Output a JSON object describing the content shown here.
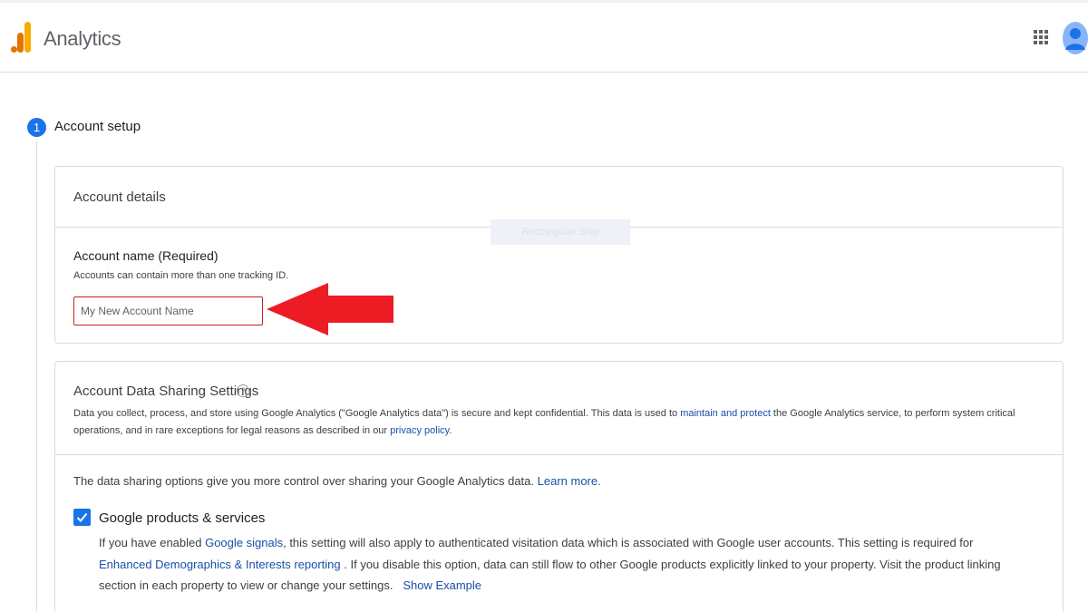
{
  "header": {
    "app_title": "Analytics",
    "logo_icon": "analytics-bars-icon",
    "apps_icon": "apps-grid-icon",
    "avatar_icon": "account-avatar-icon",
    "colors": {
      "logo_orange": "#f9ab00",
      "logo_dark_orange": "#e37400",
      "avatar_blue": "#8ab4f8"
    }
  },
  "step": {
    "number": "1",
    "label": "Account setup",
    "color": "#1a73e8"
  },
  "account_details": {
    "title": "Account details",
    "name_label": "Account name (Required)",
    "name_hint": "Accounts can contain more than one tracking ID.",
    "name_placeholder": "My New Account Name",
    "error_border_color": "#c5221f"
  },
  "overlay": {
    "ghost_tooltip": "Rectangular Snip",
    "arrow_color": "#ed1c24"
  },
  "data_sharing": {
    "title": "Account Data Sharing Settings",
    "help_icon": "?",
    "desc_part1": "Data you collect, process, and store using Google Analytics (\"Google Analytics data\") is secure and kept confidential. This data is used to ",
    "desc_link1": "maintain and protect",
    "desc_part2": " the Google Analytics service, to perform system critical operations, and in rare exceptions for legal reasons as described in our ",
    "desc_link2": "privacy policy",
    "desc_part3": ".",
    "options_intro": "The data sharing options give you more control over sharing your Google Analytics data.",
    "learn_more": "Learn more.",
    "option": {
      "checked": true,
      "title": "Google products & services",
      "desc_part1": "If you have enabled ",
      "desc_link1": "Google signals",
      "desc_part2": ", this setting will also apply to authenticated visitation data which is associated with Google user accounts. This setting is required for ",
      "desc_link2": "Enhanced Demographics & Interests reporting",
      "desc_part3": " . If you disable this option, data can still flow to other Google products explicitly linked to your property. Visit the product linking section in each property to view or change your settings.",
      "show_example": "Show Example"
    },
    "link_color": "#1a4ea8"
  }
}
